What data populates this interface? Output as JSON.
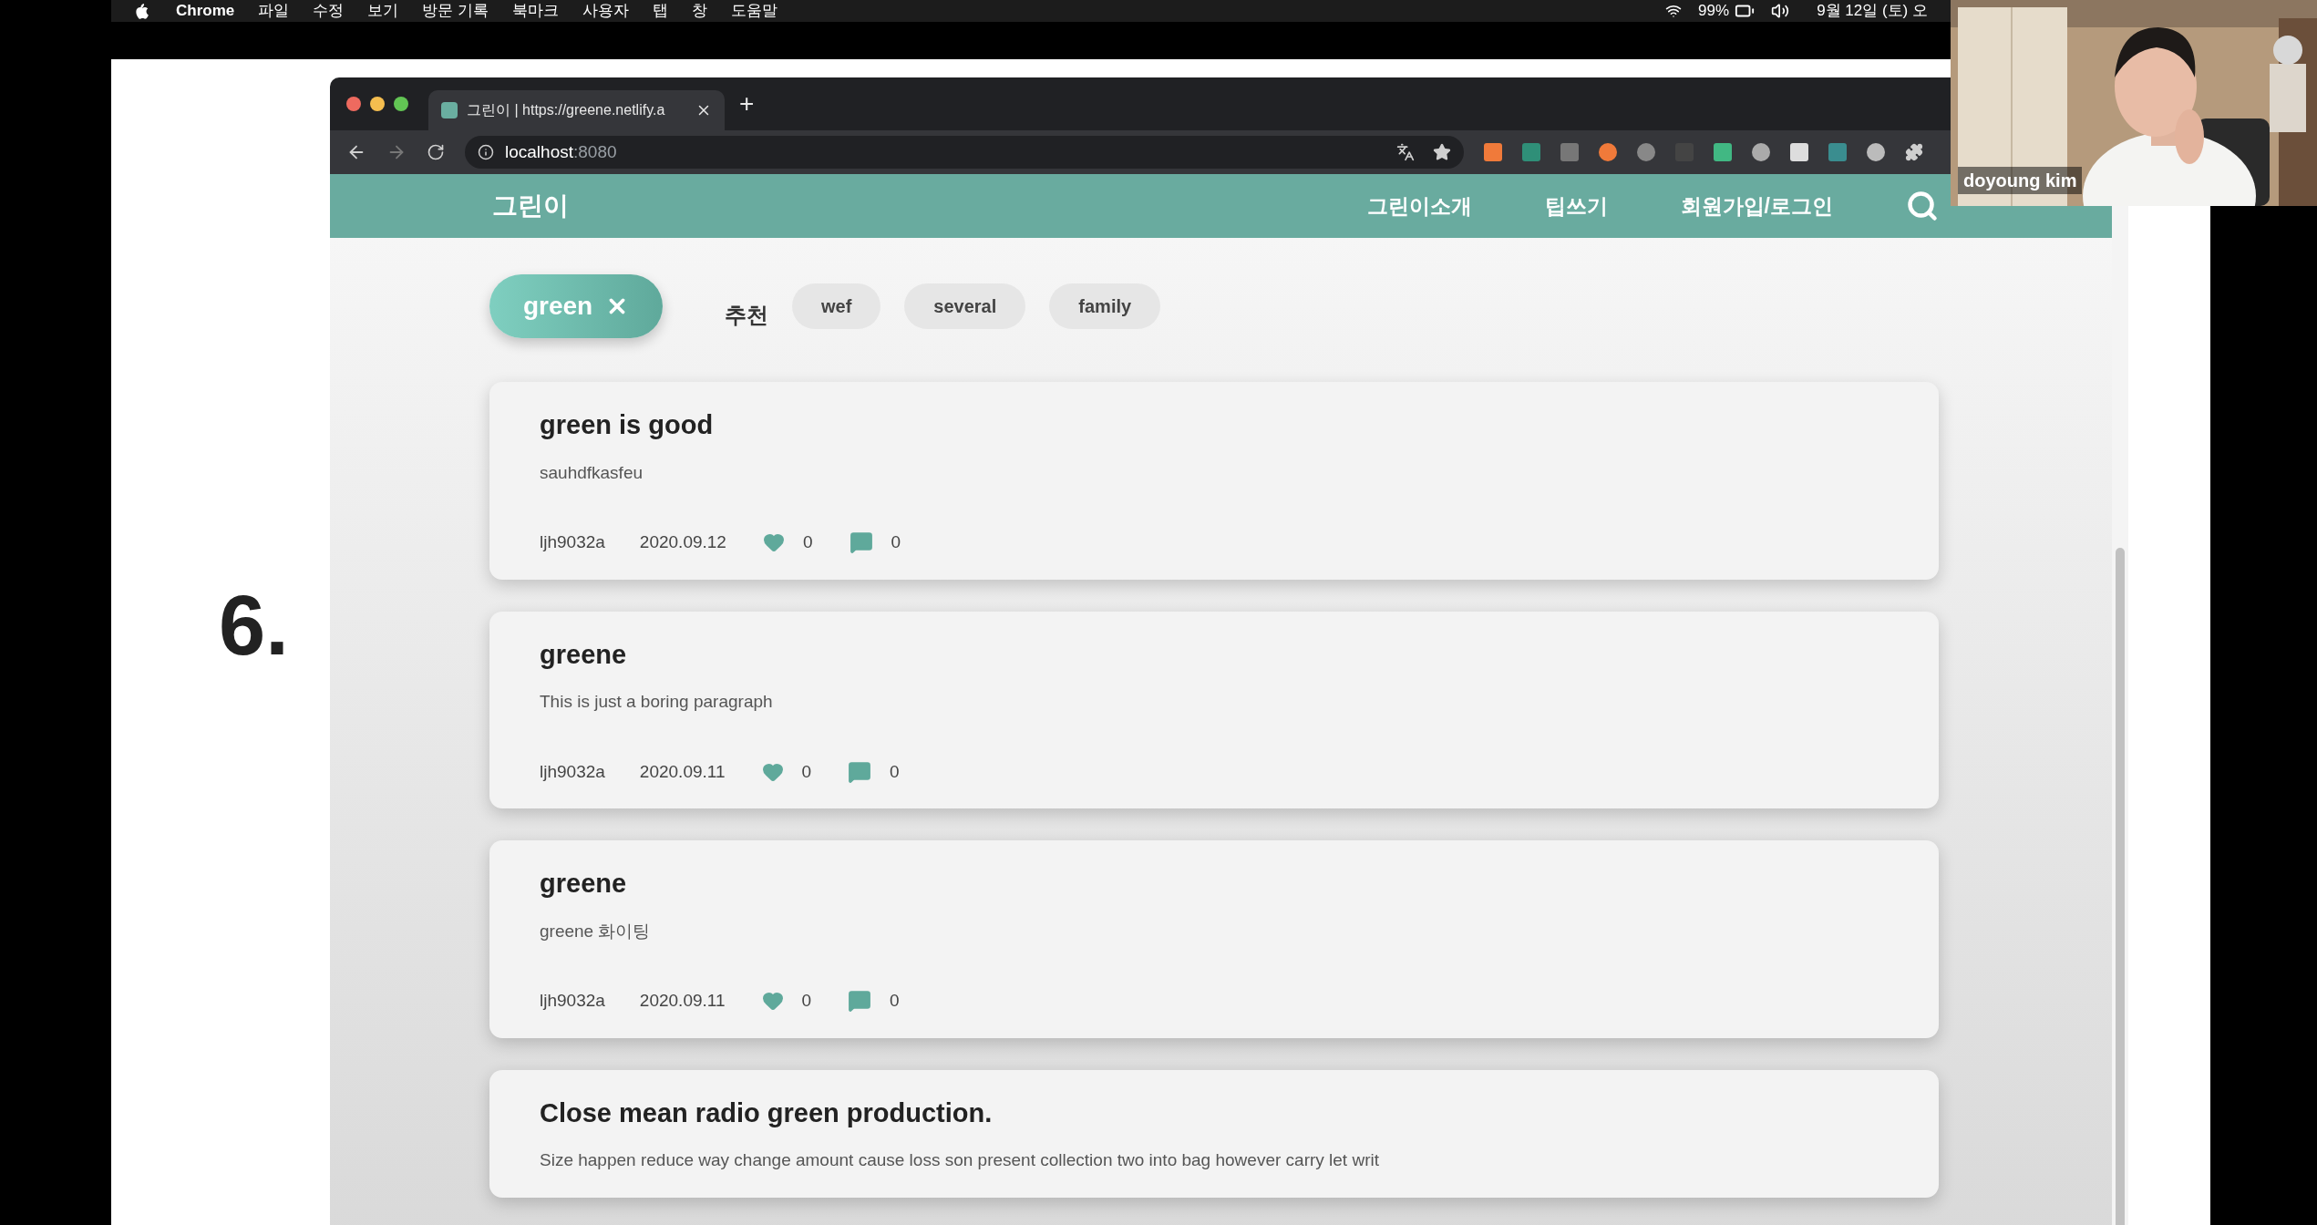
{
  "menu_bar": {
    "app": "Chrome",
    "menus": [
      "파일",
      "수정",
      "보기",
      "방문 기록",
      "북마크",
      "사용자",
      "탭",
      "창",
      "도움말"
    ],
    "battery": "99%",
    "clock": "9월 12일 (토) 오"
  },
  "slide": {
    "heading": "6."
  },
  "browser": {
    "tabs": [
      {
        "title": "그린이 | https://greene.netlify.a",
        "selected": true
      }
    ],
    "new_tab": "+",
    "address": "localhost",
    "port": ":8080"
  },
  "site": {
    "logo": "그린이",
    "nav": [
      "그린이소개",
      "팁쓰기",
      "회원가입/로그인"
    ],
    "active_filter": "green",
    "recommend_label": "추천",
    "chips": [
      "wef",
      "several",
      "family"
    ],
    "posts": [
      {
        "title": "green is good",
        "body": "sauhdfkasfeu",
        "author": "ljh9032a",
        "date": "2020.09.12",
        "likes": "0",
        "comments": "0"
      },
      {
        "title": "greene",
        "body": "This is just a boring paragraph",
        "author": "ljh9032a",
        "date": "2020.09.11",
        "likes": "0",
        "comments": "0"
      },
      {
        "title": "greene",
        "body": "greene 화이팅",
        "author": "ljh9032a",
        "date": "2020.09.11",
        "likes": "0",
        "comments": "0"
      },
      {
        "title": "Close mean radio green production.",
        "body": "Size happen reduce way change amount cause loss son present collection two into bag however carry let writ"
      }
    ]
  },
  "webcam": {
    "name": "doyoung kim"
  }
}
